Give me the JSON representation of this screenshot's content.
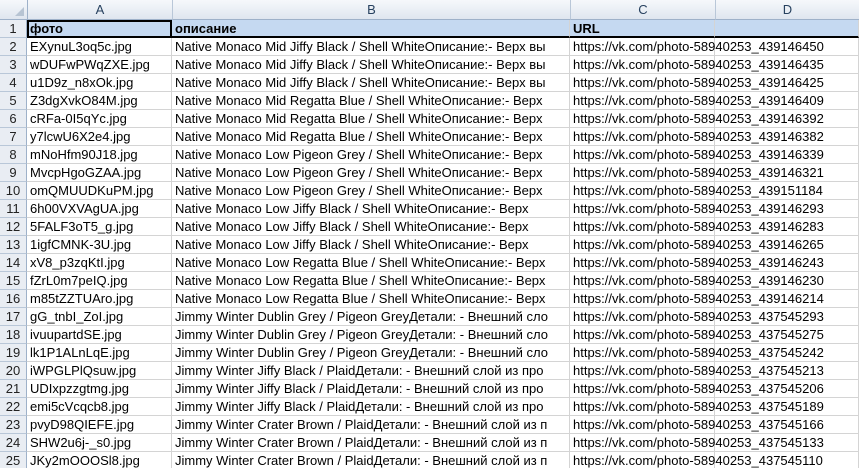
{
  "sheet": {
    "columns": [
      "A",
      "B",
      "C",
      "D"
    ],
    "header_labels": [
      "фото",
      "описание",
      "URL",
      ""
    ],
    "rows": [
      {
        "n": "2",
        "a": "EXynuL3oq5c.jpg",
        "b": "Native Monaco Mid Jiffy Black / Shell WhiteОписание:- Верх вы",
        "c": "https://vk.com/photo-58940253_439146450"
      },
      {
        "n": "3",
        "a": "wDUFwPWqZXE.jpg",
        "b": "Native Monaco Mid Jiffy Black / Shell WhiteОписание:- Верх вы",
        "c": "https://vk.com/photo-58940253_439146435"
      },
      {
        "n": "4",
        "a": "u1D9z_n8xOk.jpg",
        "b": "Native Monaco Mid Jiffy Black / Shell WhiteОписание:- Верх вы",
        "c": "https://vk.com/photo-58940253_439146425"
      },
      {
        "n": "5",
        "a": "Z3dgXvkO84M.jpg",
        "b": "Native Monaco Mid Regatta Blue / Shell WhiteОписание:- Верх",
        "c": "https://vk.com/photo-58940253_439146409"
      },
      {
        "n": "6",
        "a": "cRFa-0I5qYc.jpg",
        "b": "Native Monaco Mid Regatta Blue / Shell WhiteОписание:- Верх",
        "c": "https://vk.com/photo-58940253_439146392"
      },
      {
        "n": "7",
        "a": "y7lcwU6X2e4.jpg",
        "b": "Native Monaco Mid Regatta Blue / Shell WhiteОписание:- Верх",
        "c": "https://vk.com/photo-58940253_439146382"
      },
      {
        "n": "8",
        "a": "mNoHfm90J18.jpg",
        "b": "Native Monaco Low Pigeon Grey / Shell WhiteОписание:- Верх",
        "c": "https://vk.com/photo-58940253_439146339"
      },
      {
        "n": "9",
        "a": "MvcpHgoGZAA.jpg",
        "b": "Native Monaco Low Pigeon Grey / Shell WhiteОписание:- Верх",
        "c": "https://vk.com/photo-58940253_439146321"
      },
      {
        "n": "10",
        "a": "omQMUUDKuPM.jpg",
        "b": "Native Monaco Low Pigeon Grey / Shell WhiteОписание:- Верх",
        "c": "https://vk.com/photo-58940253_439151184"
      },
      {
        "n": "11",
        "a": "6h00VXVAgUA.jpg",
        "b": "Native Monaco Low Jiffy Black / Shell WhiteОписание:- Верх",
        "c": "https://vk.com/photo-58940253_439146293"
      },
      {
        "n": "12",
        "a": "5FALF3oT5_g.jpg",
        "b": "Native Monaco Low Jiffy Black / Shell WhiteОписание:- Верх",
        "c": "https://vk.com/photo-58940253_439146283"
      },
      {
        "n": "13",
        "a": "1igfCMNK-3U.jpg",
        "b": "Native Monaco Low Jiffy Black / Shell WhiteОписание:- Верх",
        "c": "https://vk.com/photo-58940253_439146265"
      },
      {
        "n": "14",
        "a": "xV8_p3zqKtI.jpg",
        "b": "Native Monaco Low Regatta Blue / Shell WhiteОписание:- Верх",
        "c": "https://vk.com/photo-58940253_439146243"
      },
      {
        "n": "15",
        "a": "fZrL0m7peIQ.jpg",
        "b": "Native Monaco Low Regatta Blue / Shell WhiteОписание:- Верх",
        "c": "https://vk.com/photo-58940253_439146230"
      },
      {
        "n": "16",
        "a": "m85tZZTUAro.jpg",
        "b": "Native Monaco Low Regatta Blue / Shell WhiteОписание:- Верх",
        "c": "https://vk.com/photo-58940253_439146214"
      },
      {
        "n": "17",
        "a": "gG_tnbI_ZoI.jpg",
        "b": "Jimmy Winter Dublin Grey / Pigeon GreyДетали: - Внешний сло",
        "c": "https://vk.com/photo-58940253_437545293"
      },
      {
        "n": "18",
        "a": "ivuupartdSE.jpg",
        "b": "Jimmy Winter Dublin Grey / Pigeon GreyДетали: - Внешний сло",
        "c": "https://vk.com/photo-58940253_437545275"
      },
      {
        "n": "19",
        "a": "lk1P1ALnLqE.jpg",
        "b": "Jimmy Winter Dublin Grey / Pigeon GreyДетали: - Внешний сло",
        "c": "https://vk.com/photo-58940253_437545242"
      },
      {
        "n": "20",
        "a": "iWPGLPlQsuw.jpg",
        "b": "Jimmy Winter Jiffy Black / PlaidДетали: - Внешний слой из про",
        "c": "https://vk.com/photo-58940253_437545213"
      },
      {
        "n": "21",
        "a": "UDIxpzzgtmg.jpg",
        "b": "Jimmy Winter Jiffy Black / PlaidДетали: - Внешний слой из про",
        "c": "https://vk.com/photo-58940253_437545206"
      },
      {
        "n": "22",
        "a": "emi5cVcqcb8.jpg",
        "b": "Jimmy Winter Jiffy Black / PlaidДетали: - Внешний слой из про",
        "c": "https://vk.com/photo-58940253_437545189"
      },
      {
        "n": "23",
        "a": "pvyD98QIEFE.jpg",
        "b": "Jimmy Winter Crater Brown / PlaidДетали: - Внешний слой из п",
        "c": "https://vk.com/photo-58940253_437545166"
      },
      {
        "n": "24",
        "a": "SHW2u6j-_s0.jpg",
        "b": "Jimmy Winter Crater Brown / PlaidДетали: - Внешний слой из п",
        "c": "https://vk.com/photo-58940253_437545133"
      },
      {
        "n": "25",
        "a": "JKy2mOOOSl8.jpg",
        "b": "Jimmy Winter Crater Brown / PlaidДетали: - Внешний слой из п",
        "c": "https://vk.com/photo-58940253_437545110"
      }
    ]
  }
}
